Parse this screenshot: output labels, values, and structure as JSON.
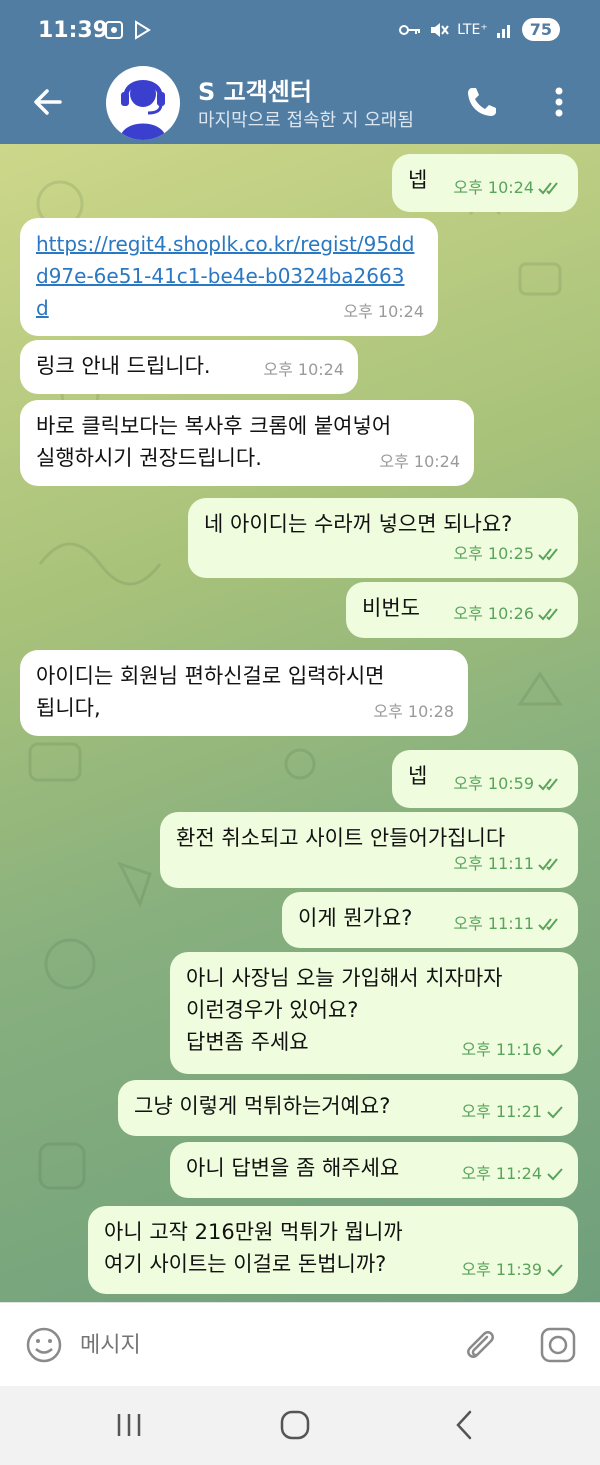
{
  "status_bar": {
    "time": "11:39",
    "network": "LTE⁺",
    "battery": "75"
  },
  "header": {
    "title": "S 고객센터",
    "subtitle": "마지막으로 접속한 지 오래됨"
  },
  "messages": [
    {
      "text": "넵",
      "time": "오후 10:24",
      "status": "read"
    },
    {
      "text": "https://regit4.shoplk.co.kr/regist/95ddd97e-6e51-41c1-be4e-b0324ba2663d",
      "time": "오후 10:24",
      "link": true
    },
    {
      "text": "링크 안내 드립니다.",
      "time": "오후 10:24"
    },
    {
      "text": "바로 클릭보다는 복사후 크롬에 붙여넣어\n실행하시기 권장드립니다.",
      "time": "오후 10:24"
    },
    {
      "text": "네 아이디는 수라꺼 넣으면 되나요?",
      "time": "오후 10:25",
      "status": "read"
    },
    {
      "text": "비번도",
      "time": "오후 10:26",
      "status": "read"
    },
    {
      "text": "아이디는 회원님 편하신걸로 입력하시면\n됩니다,",
      "time": "오후 10:28"
    },
    {
      "text": "넵",
      "time": "오후 10:59",
      "status": "read"
    },
    {
      "text": "환전 취소되고 사이트 안들어가집니다",
      "time": "오후 11:11",
      "status": "read"
    },
    {
      "text": "이게 뭔가요?",
      "time": "오후 11:11",
      "status": "read"
    },
    {
      "text": "아니 사장님 오늘 가입해서 치자마자\n이런경우가 있어요?\n답변좀 주세요",
      "time": "오후 11:16",
      "status": "sent"
    },
    {
      "text": "그냥 이렇게 먹튀하는거예요?",
      "time": "오후 11:21",
      "status": "sent"
    },
    {
      "text": "아니 답변을 좀 해주세요",
      "time": "오후 11:24",
      "status": "sent"
    },
    {
      "text": "아니 고작 216만원 먹튀가 뭡니까\n여기 사이트는 이걸로 돈법니까?",
      "time": "오후 11:39",
      "status": "sent"
    }
  ],
  "input": {
    "placeholder": "메시지"
  },
  "icons": {
    "back": "arrow-left-icon",
    "call": "phone-icon",
    "menu": "more-vertical-icon",
    "emoji": "emoji-icon",
    "attach": "paperclip-icon",
    "camera": "camera-icon"
  },
  "colors": {
    "header": "#527da3",
    "bubble_out": "#effdde",
    "bubble_in": "#ffffff",
    "check": "#5aa35c",
    "link": "#2b78c2"
  }
}
